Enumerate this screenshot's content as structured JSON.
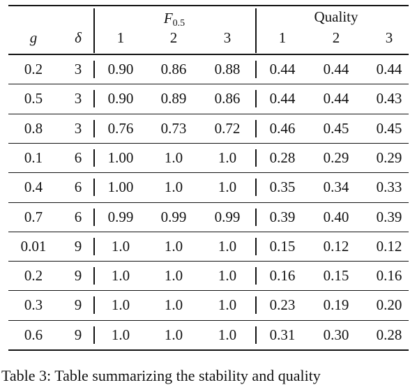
{
  "header": {
    "g": "g",
    "delta": "δ",
    "group1": {
      "symbol": "F",
      "subscript": "0.5"
    },
    "group2": "Quality",
    "subcols": [
      "1",
      "2",
      "3",
      "1",
      "2",
      "3"
    ]
  },
  "rows": [
    [
      "0.2",
      "3",
      "0.90",
      "0.86",
      "0.88",
      "0.44",
      "0.44",
      "0.44"
    ],
    [
      "0.5",
      "3",
      "0.90",
      "0.89",
      "0.86",
      "0.44",
      "0.44",
      "0.43"
    ],
    [
      "0.8",
      "3",
      "0.76",
      "0.73",
      "0.72",
      "0.46",
      "0.45",
      "0.45"
    ],
    [
      "0.1",
      "6",
      "1.00",
      "1.0",
      "1.0",
      "0.28",
      "0.29",
      "0.29"
    ],
    [
      "0.4",
      "6",
      "1.00",
      "1.0",
      "1.0",
      "0.35",
      "0.34",
      "0.33"
    ],
    [
      "0.7",
      "6",
      "0.99",
      "0.99",
      "0.99",
      "0.39",
      "0.40",
      "0.39"
    ],
    [
      "0.01",
      "9",
      "1.0",
      "1.0",
      "1.0",
      "0.15",
      "0.12",
      "0.12"
    ],
    [
      "0.2",
      "9",
      "1.0",
      "1.0",
      "1.0",
      "0.16",
      "0.15",
      "0.16"
    ],
    [
      "0.3",
      "9",
      "1.0",
      "1.0",
      "1.0",
      "0.23",
      "0.19",
      "0.20"
    ],
    [
      "0.6",
      "9",
      "1.0",
      "1.0",
      "1.0",
      "0.31",
      "0.30",
      "0.28"
    ]
  ],
  "caption": "Table 3: Table summarizing the stability and quality"
}
